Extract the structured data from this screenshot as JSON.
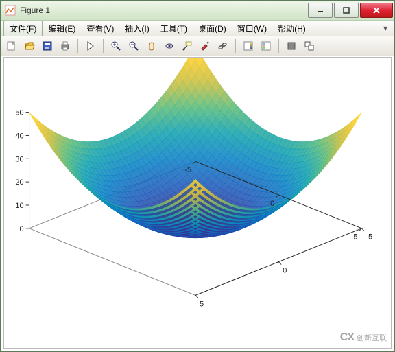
{
  "window": {
    "title": "Figure 1"
  },
  "menu": {
    "file": {
      "label": "文件",
      "suffix": "(F)"
    },
    "edit": {
      "label": "编辑",
      "suffix": "(E)"
    },
    "view": {
      "label": "查看",
      "suffix": "(V)"
    },
    "insert": {
      "label": "插入",
      "suffix": "(I)"
    },
    "tools": {
      "label": "工具",
      "suffix": "(T)"
    },
    "desktop": {
      "label": "桌面",
      "suffix": "(D)"
    },
    "window": {
      "label": "窗口",
      "suffix": "(W)"
    },
    "help": {
      "label": "帮助",
      "suffix": "(H)"
    }
  },
  "toolbar": {
    "new": "新建",
    "open": "打开",
    "save": "保存",
    "print": "打印",
    "edit_plot": "编辑绘图",
    "zoom_in": "放大",
    "zoom_out": "缩小",
    "pan": "平移",
    "rotate_3d": "三维旋转",
    "datatip": "数据提示",
    "brush": "刷选",
    "link": "链接",
    "colorbar": "颜色栏",
    "legend": "图例",
    "hide": "隐藏",
    "dock": "停靠"
  },
  "watermark": {
    "logo": "CX",
    "text": "创新互联"
  },
  "chart_data": {
    "type": "surface",
    "equation": "z = x^2 + y^2",
    "x_range": [
      -5,
      5
    ],
    "y_range": [
      -5,
      5
    ],
    "z_range": [
      0,
      50
    ],
    "x_ticks": [
      -5,
      0,
      5
    ],
    "y_ticks": [
      -5,
      0,
      5
    ],
    "z_ticks": [
      0,
      10,
      20,
      30,
      40,
      50
    ],
    "colormap": "parula",
    "style": "mesh",
    "title": "",
    "xlabel": "",
    "ylabel": "",
    "zlabel": ""
  }
}
